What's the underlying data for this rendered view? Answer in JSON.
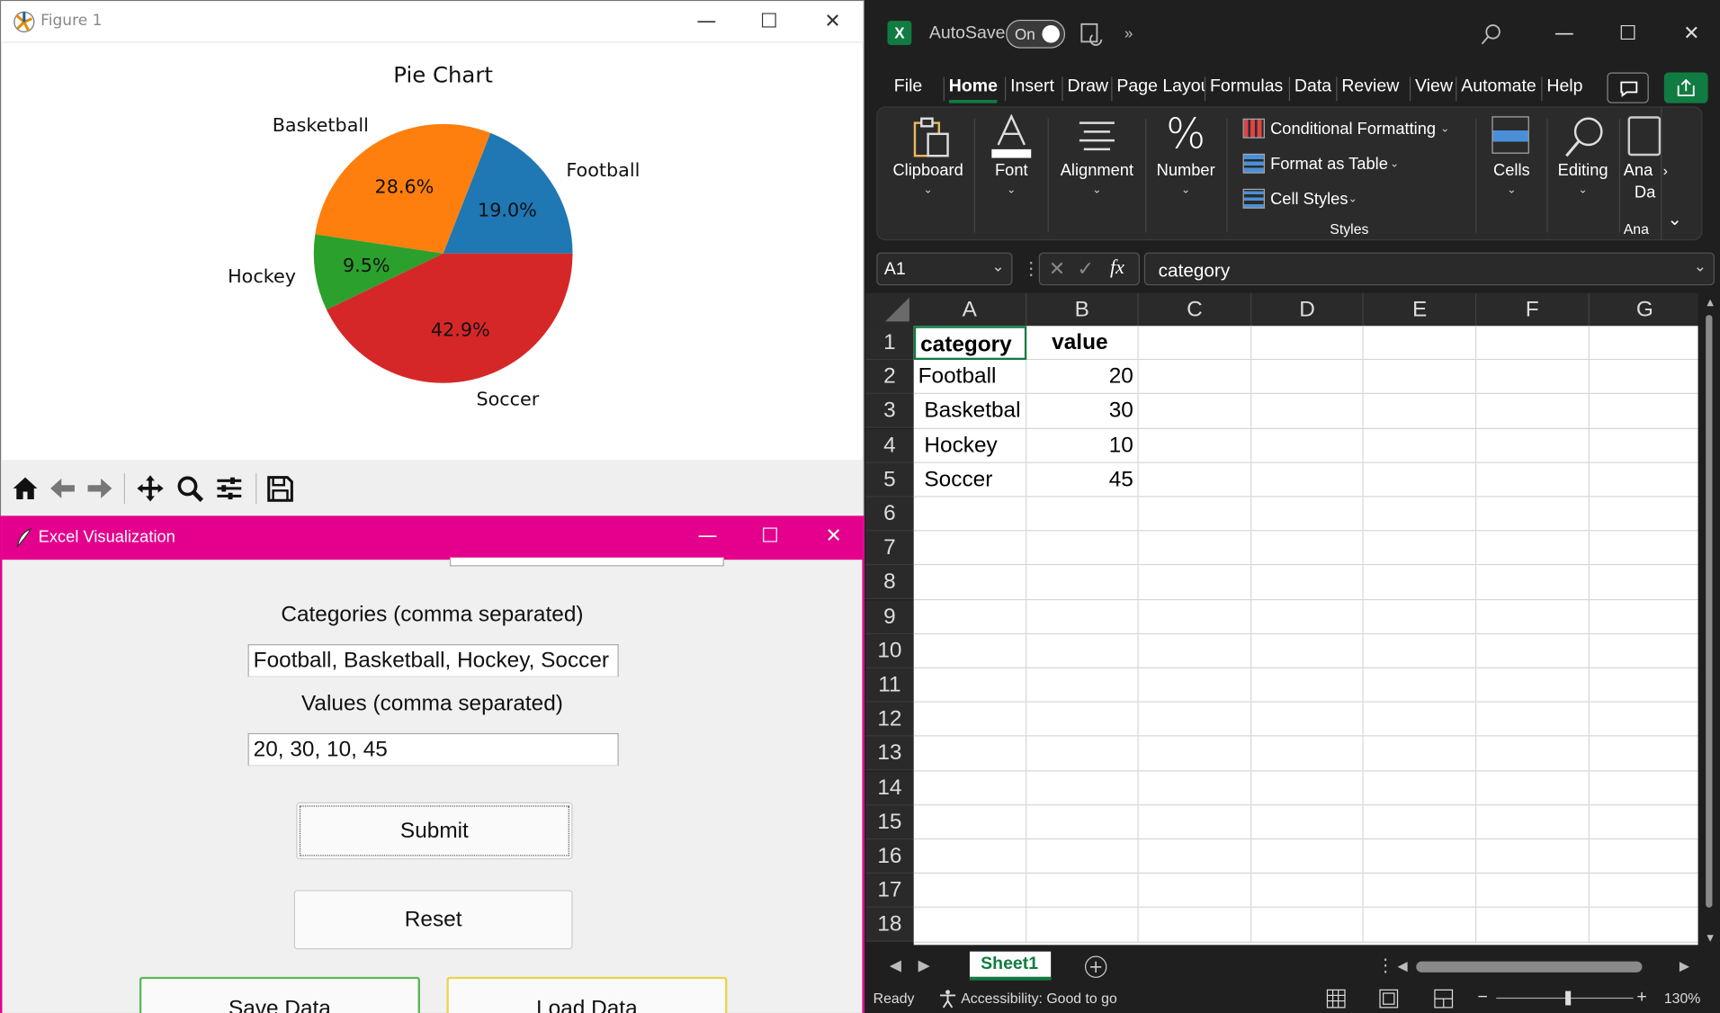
{
  "figure_window": {
    "title": "Figure 1",
    "chart_data": {
      "type": "pie",
      "title": "Pie Chart",
      "slices": [
        {
          "label": "Football",
          "value": 20,
          "pct_label": "19.0%",
          "color": "#1f77b4"
        },
        {
          "label": "Basketball",
          "value": 30,
          "pct_label": "28.6%",
          "color": "#ff7f0e"
        },
        {
          "label": "Hockey",
          "value": 10,
          "pct_label": "9.5%",
          "color": "#2ca02c"
        },
        {
          "label": "Soccer",
          "value": 45,
          "pct_label": "42.9%",
          "color": "#d62728"
        }
      ]
    },
    "toolbar_icons": [
      "home-icon",
      "back-arrow-icon",
      "forward-arrow-icon",
      "pan-icon",
      "zoom-icon",
      "configure-icon",
      "save-icon"
    ]
  },
  "tk_window": {
    "title": "Excel Visualization",
    "categories_label": "Categories (comma separated)",
    "categories_value": "Football, Basketball, Hockey, Soccer",
    "values_label": "Values (comma separated)",
    "values_value": "20, 30, 10, 45",
    "submit_label": "Submit",
    "reset_label": "Reset",
    "save_label": "Save Data",
    "load_label": "Load Data",
    "accent_color": "#e4008c"
  },
  "excel": {
    "autosave_label": "AutoSave",
    "autosave_state": "On",
    "menu": [
      "File",
      "Home",
      "Insert",
      "Draw",
      "Page Layou",
      "Formulas",
      "Data",
      "Review",
      "View",
      "Automate",
      "Help"
    ],
    "active_menu": "Home",
    "ribbon": {
      "clipboard": "Clipboard",
      "font": "Font",
      "alignment": "Alignment",
      "number": "Number",
      "conditional_formatting": "Conditional Formatting",
      "format_as_table": "Format as Table",
      "cell_styles": "Cell Styles",
      "styles_group": "Styles",
      "cells": "Cells",
      "editing": "Editing",
      "analyze_line1": "Ana",
      "analyze_line2": "Da",
      "analyze_group": "Ana"
    },
    "name_box": "A1",
    "formula_value": "category",
    "fx_label": "fx",
    "columns": [
      "A",
      "B",
      "C",
      "D",
      "E",
      "F",
      "G"
    ],
    "rows": [
      "1",
      "2",
      "3",
      "4",
      "5",
      "6",
      "7",
      "8",
      "9",
      "10",
      "11",
      "12",
      "13",
      "14",
      "15",
      "16",
      "17",
      "18"
    ],
    "cells": [
      {
        "a": "category",
        "b": "value"
      },
      {
        "a": "Football",
        "b": "20"
      },
      {
        "a": " Basketbal",
        "b": "30"
      },
      {
        "a": " Hockey",
        "b": "10"
      },
      {
        "a": " Soccer",
        "b": "45"
      }
    ],
    "sheet_tab": "Sheet1",
    "status_ready": "Ready",
    "status_accessibility": "Accessibility: Good to go",
    "zoom": "130%",
    "accent_color": "#107c41"
  }
}
